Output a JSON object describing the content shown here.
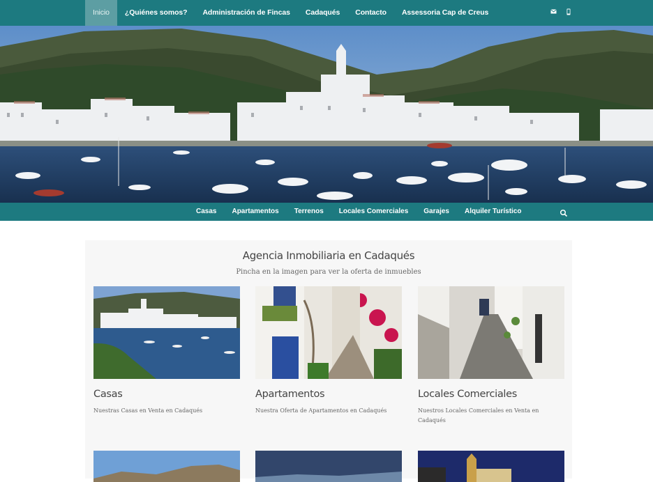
{
  "colors": {
    "nav_bg": "#1d7a80",
    "nav_active_bg": "#5d9ea3",
    "panel_bg": "#f7f7f7"
  },
  "top_nav": {
    "items": [
      {
        "label": "Inicio",
        "active": true
      },
      {
        "label": "¿Quiénes somos?"
      },
      {
        "label": "Administración de Fincas"
      },
      {
        "label": "Cadaqués"
      },
      {
        "label": "Contacto"
      },
      {
        "label": "Assessoria Cap de Creus"
      }
    ],
    "icons": [
      "mail-icon",
      "mobile-phone-icon"
    ]
  },
  "sub_nav": {
    "items": [
      {
        "label": "Casas"
      },
      {
        "label": "Apartamentos"
      },
      {
        "label": "Terrenos"
      },
      {
        "label": "Locales Comerciales"
      },
      {
        "label": "Garajes"
      },
      {
        "label": "Alquiler Turístico"
      }
    ],
    "search_icon": "search-icon"
  },
  "main": {
    "title": "Agencia Inmobiliaria en Cadaqués",
    "subtitle": "Pincha en la imagen para ver la oferta de inmuebles",
    "cards": [
      {
        "title": "Casas",
        "description": "Nuestras Casas en Venta en Cadaqués"
      },
      {
        "title": "Apartamentos",
        "description": "Nuestra Oferta de Apartamentos en Cadaqués"
      },
      {
        "title": "Locales Comerciales",
        "description": "Nuestros Locales Comerciales en Venta en Cadaqués"
      }
    ]
  }
}
